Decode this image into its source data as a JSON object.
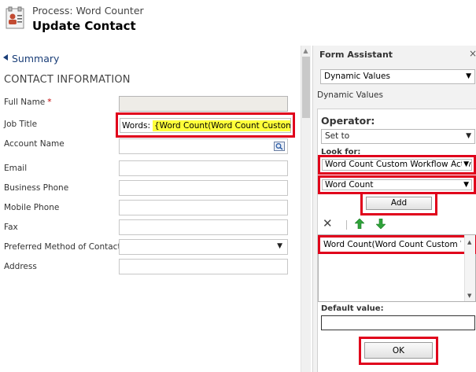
{
  "header": {
    "process_label": "Process: Word Counter",
    "title": "Update Contact",
    "icon": "contact-card-icon"
  },
  "form": {
    "summary_link": "Summary",
    "section_title": "CONTACT INFORMATION",
    "required_marker": "*",
    "fields": {
      "full_name": {
        "label": "Full Name",
        "value": ""
      },
      "job_title": {
        "label": "Job Title",
        "prefix": "Words:",
        "token": "{Word Count(Word Count Custom Workflow Activity)}"
      },
      "account_name": {
        "label": "Account Name",
        "value": ""
      },
      "email": {
        "label": "Email",
        "value": ""
      },
      "business_phone": {
        "label": "Business Phone",
        "value": ""
      },
      "mobile_phone": {
        "label": "Mobile Phone",
        "value": ""
      },
      "fax": {
        "label": "Fax",
        "value": ""
      },
      "preferred_method": {
        "label": "Preferred Method of Contact",
        "value": ""
      },
      "address": {
        "label": "Address",
        "value": ""
      }
    }
  },
  "assistant": {
    "title": "Form Assistant",
    "close_glyph": "×",
    "mode_select": "Dynamic Values",
    "sub_title": "Dynamic Values",
    "operator_label": "Operator:",
    "operator_value": "Set to",
    "look_for_label": "Look for:",
    "look_for_entity": "Word Count Custom Workflow Activity",
    "look_for_attribute": "Word Count",
    "add_label": "Add",
    "list_items": [
      "Word Count(Word Count Custom Workflow Activity)"
    ],
    "default_value_label": "Default value:",
    "default_value": "",
    "ok_label": "OK"
  },
  "colors": {
    "highlight_red": "#e0001b",
    "token_yellow": "#ffff3a",
    "link_blue": "#1a3e78",
    "arrow_green": "#2fa33a"
  }
}
